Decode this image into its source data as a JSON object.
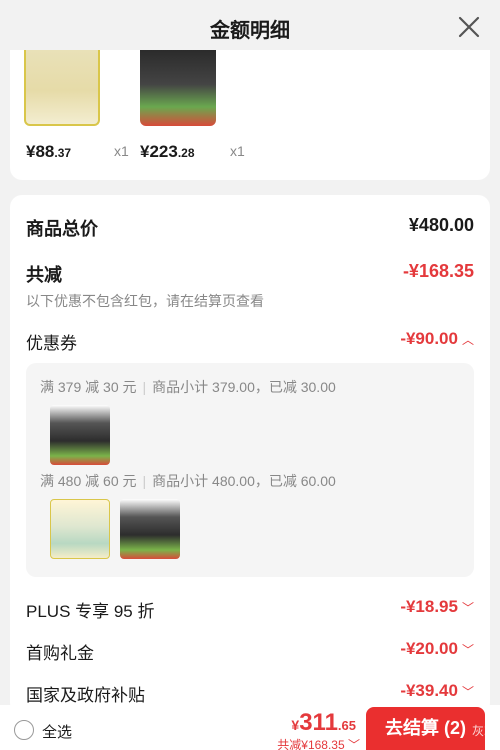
{
  "header": {
    "title": "金额明细"
  },
  "products": [
    {
      "price_int": "¥88",
      "price_dec": ".37",
      "qty": "x1"
    },
    {
      "price_int": "¥223",
      "price_dec": ".28",
      "qty": "x1"
    }
  ],
  "summary": {
    "total_label": "商品总价",
    "total_value": "¥480.00",
    "reduce_label": "共减",
    "reduce_value": "-¥168.35",
    "reduce_note": "以下优惠不包含红包，请在结算页查看",
    "coupon_label": "优惠券",
    "coupon_value": "-¥90.00",
    "coupon_lines": [
      {
        "rule": "满 379 减 30 元",
        "detail": "商品小计 379.00，已减 30.00"
      },
      {
        "rule": "满 480 减 60 元",
        "detail": "商品小计 480.00，已减 60.00"
      }
    ],
    "plus_label": "PLUS 专享 95 折",
    "plus_value": "-¥18.95",
    "first_label": "首购礼金",
    "first_value": "-¥20.00",
    "gov_label": "国家及政府补贴",
    "gov_value": "-¥39.40"
  },
  "bottom": {
    "select_all": "全选",
    "yen": "¥",
    "total_int": "311",
    "total_dec": ".65",
    "saved": "共减¥168.35",
    "checkout": "去结算 (2)",
    "watermark": "灰灰"
  },
  "colors": {
    "accent": "#e4393c",
    "button": "#ea2f2f"
  }
}
